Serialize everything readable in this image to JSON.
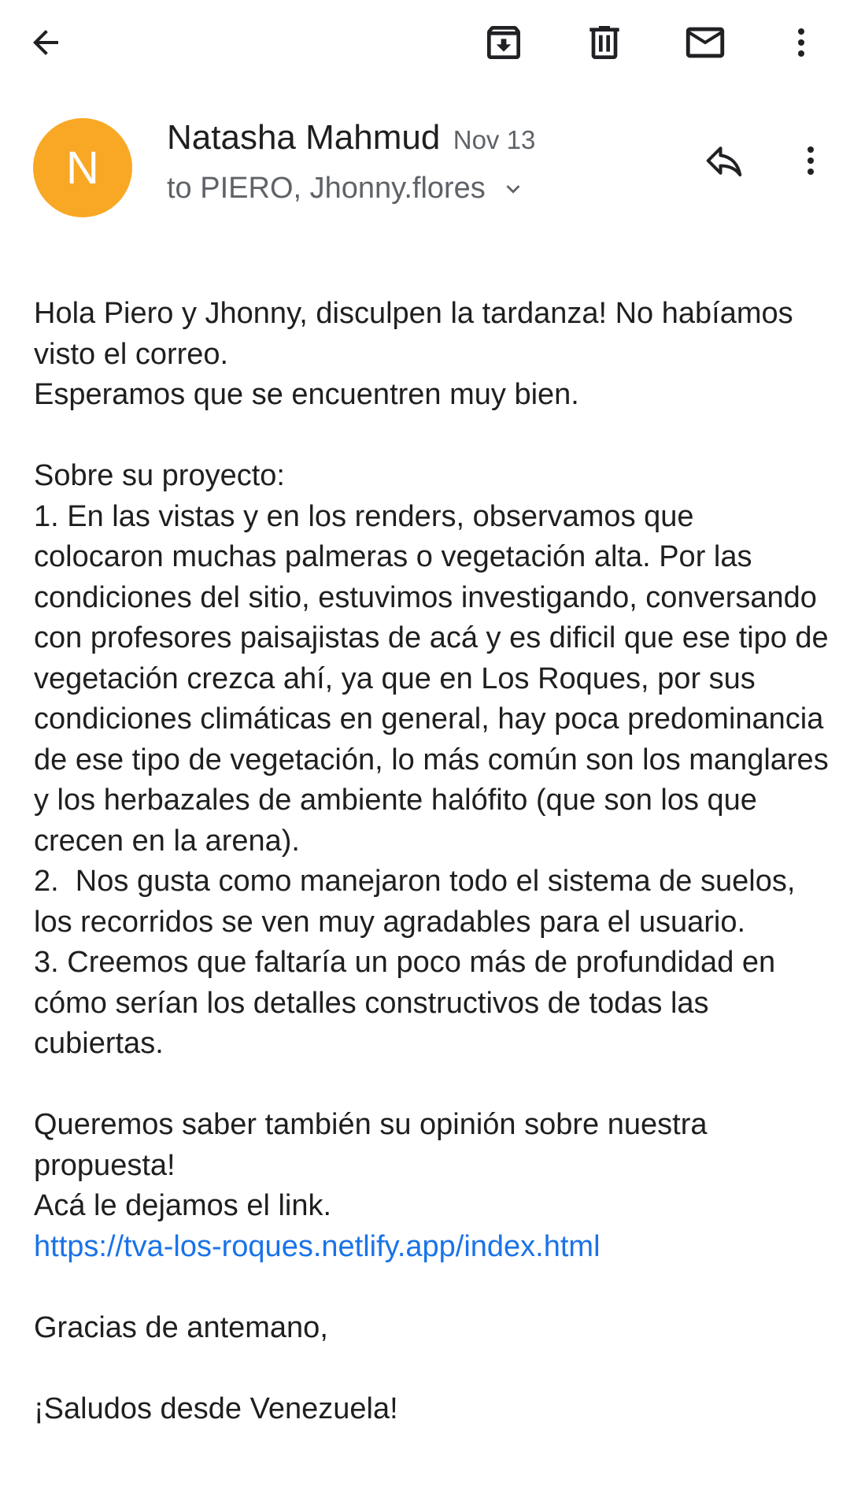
{
  "toolbar": {
    "back": "back-arrow-icon",
    "archive": "archive-icon",
    "delete": "delete-icon",
    "mark_unread": "mail-icon",
    "more": "more-vert-icon"
  },
  "email": {
    "sender": {
      "name": "Natasha Mahmud",
      "initial": "N",
      "avatar_color": "#f9a825"
    },
    "date": "Nov 13",
    "recipients": "to PIERO, Jhonny.flores",
    "body": {
      "greeting": [
        "Hola Piero y Jhonny, disculpen la tardanza! No habíamos visto el correo.",
        "Esperamos que se encuentren muy bien."
      ],
      "project": [
        "Sobre su proyecto:",
        "1. En las vistas y en los renders, observamos que colocaron muchas palmeras o vegetación alta. Por las condiciones del sitio, estuvimos investigando, conversando con profesores paisajistas de acá y es dificil que ese tipo de vegetación crezca ahí, ya que en Los Roques, por sus condiciones climáticas en general, hay poca predominancia de ese tipo de vegetación, lo más común son los manglares y los herbazales de ambiente halófito (que son los que crecen en la arena).",
        "2.  Nos gusta como manejaron todo el sistema de suelos, los recorridos se ven muy agradables para el usuario.",
        "3. Creemos que faltaría un poco más de profundidad en cómo serían los detalles constructivos de todas las cubiertas."
      ],
      "request": [
        "Queremos saber también su opinión sobre nuestra propuesta!",
        "Acá le dejamos el link."
      ],
      "link": "https://tva-los-roques.netlify.app/index.html",
      "thanks": "Gracias de antemano,",
      "closing": "¡Saludos desde Venezuela!"
    }
  },
  "colors": {
    "link": "#1a73e8",
    "icon": "#202124",
    "secondary_text": "#5f6368"
  }
}
